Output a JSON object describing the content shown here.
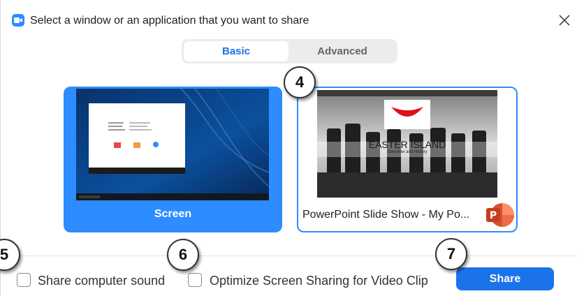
{
  "window": {
    "title": "Select a window or an application that you want to share",
    "app_icon": "zoom-camera-icon",
    "close_icon": "close-icon"
  },
  "tabs": [
    {
      "label": "Basic",
      "selected": true
    },
    {
      "label": "Advanced",
      "selected": false
    }
  ],
  "share_options": [
    {
      "label": "Screen",
      "selected": false
    },
    {
      "label": "PowerPoint Slide Show  -  My Po...",
      "app_icon": "powerpoint-icon",
      "selected": true,
      "preview_slide": {
        "title": "EASTER ISLAND",
        "subtitle": "Overview and History"
      }
    }
  ],
  "options": {
    "share_sound": {
      "label": "Share computer sound",
      "checked": false
    },
    "optimize_video": {
      "label": "Optimize Screen Sharing for Video Clip",
      "checked": false
    }
  },
  "actions": {
    "share_label": "Share"
  },
  "callouts": [
    "4",
    "5",
    "6",
    "7"
  ],
  "colors": {
    "accent": "#2D8CFF",
    "button": "#1a73e8"
  }
}
